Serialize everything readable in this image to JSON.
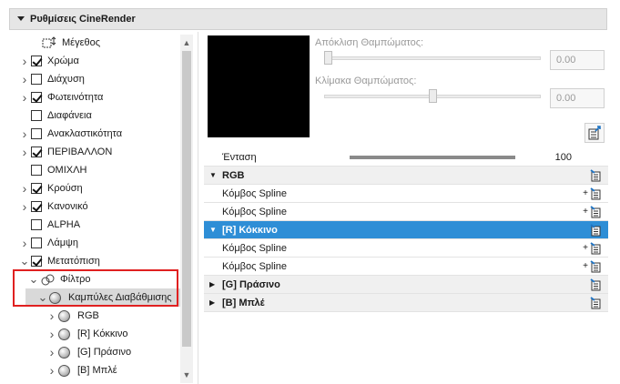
{
  "panel": {
    "title": "Ρυθμίσεις CineRender"
  },
  "tree": {
    "items": [
      {
        "label": "Μέγεθος",
        "chevron": "",
        "checkbox": "none",
        "icon": "size-icon"
      },
      {
        "label": "Χρώμα",
        "chevron": ">",
        "checkbox": "checked"
      },
      {
        "label": "Διάχυση",
        "chevron": ">",
        "checkbox": "unchecked"
      },
      {
        "label": "Φωτεινότητα",
        "chevron": ">",
        "checkbox": "checked"
      },
      {
        "label": "Διαφάνεια",
        "chevron": "",
        "checkbox": "unchecked"
      },
      {
        "label": "Ανακλαστικότητα",
        "chevron": ">",
        "checkbox": "unchecked"
      },
      {
        "label": "ΠΕΡΙΒΑΛΛΟΝ",
        "chevron": ">",
        "checkbox": "checked"
      },
      {
        "label": "ΟΜΙΧΛΗ",
        "chevron": "",
        "checkbox": "unchecked"
      },
      {
        "label": "Κρούση",
        "chevron": ">",
        "checkbox": "checked"
      },
      {
        "label": "Κανονικό",
        "chevron": ">",
        "checkbox": "checked"
      },
      {
        "label": "ALPHA",
        "chevron": "",
        "checkbox": "unchecked"
      },
      {
        "label": "Λάμψη",
        "chevron": ">",
        "checkbox": "unchecked"
      },
      {
        "label": "Μετατόπιση",
        "chevron": "v",
        "checkbox": "checked"
      },
      {
        "label": "Φίλτρο",
        "chevron": "v",
        "checkbox": "none",
        "icon": "filter-icon"
      },
      {
        "label": "Καμπύλες Διαβάθμισης",
        "chevron": "v",
        "checkbox": "none",
        "icon": "sphere-icon",
        "selected": true
      },
      {
        "label": "RGB",
        "chevron": ">",
        "checkbox": "none",
        "icon": "sphere-icon"
      },
      {
        "label": "[R] Κόκκινο",
        "chevron": ">",
        "checkbox": "none",
        "icon": "sphere-icon"
      },
      {
        "label": "[G] Πράσινο",
        "chevron": ">",
        "checkbox": "none",
        "icon": "sphere-icon"
      },
      {
        "label": "[B] Μπλέ",
        "chevron": ">",
        "checkbox": "none",
        "icon": "sphere-icon"
      }
    ]
  },
  "preview": {
    "shadow_deviation_label": "Απόκλιση Θαμπώματος:",
    "shadow_deviation_value": "0.00",
    "shadow_scale_label": "Κλίμακα Θαμπώματος:",
    "shadow_scale_value": "0.00"
  },
  "table": {
    "intensity_label": "Ένταση",
    "intensity_value": "100",
    "rows": [
      {
        "type": "group",
        "label": "RGB",
        "expanded": true
      },
      {
        "type": "item",
        "label": "Κόμβος Spline"
      },
      {
        "type": "item",
        "label": "Κόμβος Spline"
      },
      {
        "type": "active",
        "label": "[R] Κόκκινο",
        "expanded": true
      },
      {
        "type": "item",
        "label": "Κόμβος Spline"
      },
      {
        "type": "item",
        "label": "Κόμβος Spline"
      },
      {
        "type": "group",
        "label": "[G] Πράσινο",
        "expanded": false
      },
      {
        "type": "group",
        "label": "[B] Μπλέ",
        "expanded": false
      }
    ]
  },
  "colors": {
    "accent": "#2e8ed6",
    "highlight_box": "#e02020"
  }
}
